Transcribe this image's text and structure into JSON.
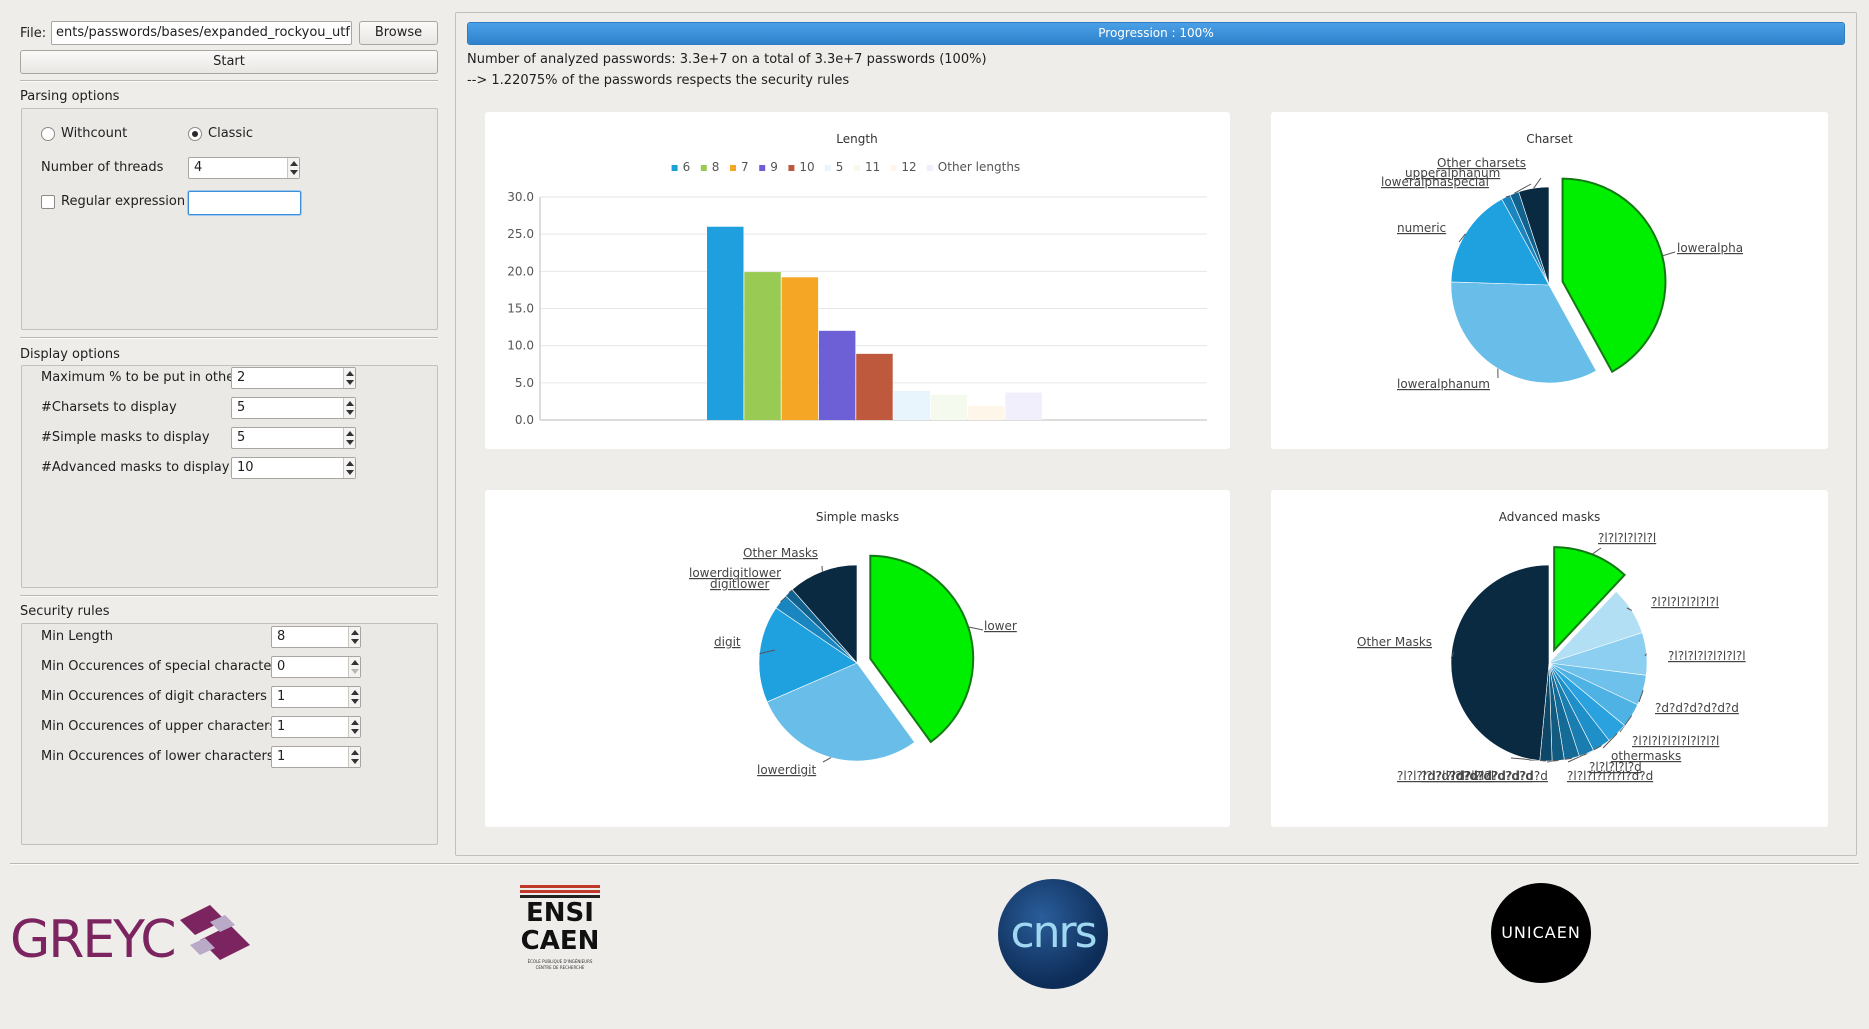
{
  "file": {
    "label": "File:",
    "path": "ents/passwords/bases/expanded_rockyou_utf8.txt",
    "browse_label": "Browse",
    "start_label": "Start"
  },
  "parsing": {
    "title": "Parsing options",
    "withcount_label": "Withcount",
    "classic_label": "Classic",
    "selected_mode": "Classic",
    "threads_label": "Number of threads",
    "threads_value": "4",
    "regex_label": "Regular expression",
    "regex_checked": false,
    "regex_value": ""
  },
  "display": {
    "title": "Display options",
    "rows": [
      {
        "label": "Maximum % to be put in other",
        "value": "2"
      },
      {
        "label": "#Charsets to display",
        "value": "5"
      },
      {
        "label": "#Simple masks to display",
        "value": "5"
      },
      {
        "label": "#Advanced masks to display",
        "value": "10"
      }
    ]
  },
  "security": {
    "title": "Security rules",
    "rows": [
      {
        "label": "Min Length",
        "value": "8"
      },
      {
        "label": "Min Occurences of special characters",
        "value": "0"
      },
      {
        "label": "Min Occurences of digit characters",
        "value": "1"
      },
      {
        "label": "Min Occurences of upper characters",
        "value": "1"
      },
      {
        "label": "Min Occurences of lower characters",
        "value": "1"
      }
    ]
  },
  "progress": {
    "label": "Progression : 100%",
    "value": 100,
    "color": "#3a8fd8"
  },
  "status": {
    "line1": "Number of analyzed passwords: 3.3e+7 on a total of 3.3e+7 passwords (100%)",
    "line2": "--> 1.22075% of the passwords respects the security rules"
  },
  "chart_data": [
    {
      "type": "bar",
      "title": "Length",
      "categories": [
        "6",
        "8",
        "7",
        "9",
        "10",
        "5",
        "11",
        "12",
        "Other lengths"
      ],
      "values": [
        26.0,
        19.9,
        19.2,
        12.0,
        8.9,
        3.9,
        3.4,
        1.9,
        3.7
      ],
      "colors": [
        "#209fdf",
        "#99ca53",
        "#f6a625",
        "#6d5fd5",
        "#bf593e",
        "#e9f5fc",
        "#f4faed",
        "#fef6e9",
        "#f0effb"
      ],
      "ylim": [
        0,
        30
      ],
      "yticks": [
        "0.0",
        "5.0",
        "10.0",
        "15.0",
        "20.0",
        "25.0",
        "30.0"
      ],
      "legend": "top",
      "grid": true
    },
    {
      "type": "pie",
      "title": "Charset",
      "labels": [
        "loweralpha",
        "loweralphanum",
        "numeric",
        "loweralphaspecial",
        "upperalphanum",
        "Other charsets"
      ],
      "values": [
        42.0,
        33.5,
        16.5,
        1.5,
        1.5,
        5.0
      ],
      "colors": [
        "#00ee00",
        "#68bde9",
        "#1fa0df",
        "#1a86c0",
        "#12628f",
        "#0a2a42"
      ],
      "exploded": "loweralpha"
    },
    {
      "type": "pie",
      "title": "Simple masks",
      "labels": [
        "lower",
        "lowerdigit",
        "digit",
        "digitlower",
        "lowerdigitlower",
        "Other Masks"
      ],
      "values": [
        40.0,
        28.5,
        16.0,
        2.5,
        1.5,
        11.5
      ],
      "colors": [
        "#00ee00",
        "#68bde9",
        "#1fa0df",
        "#1a86c0",
        "#12628f",
        "#0a2a42"
      ],
      "exploded": "lower"
    },
    {
      "type": "pie",
      "title": "Advanced masks",
      "labels": [
        "?l?l?l?l?l?l",
        "?l?l?l?l?l?l?l",
        "?l?l?l?l?l?l?l?l",
        "?d?d?d?d?d?d",
        "?l?l?l?l?l?l?l?l?l",
        "othermasks",
        "?l?l?l?l?d",
        "?l?l?l?l?l?l?d?d",
        "?d?d?d?d?d?d?d",
        "?d?d?d?d?d?d?d?d",
        "?l?l?l?l?l?l?l?l?l?l",
        "Other Masks"
      ],
      "values": [
        12.0,
        8.0,
        7.0,
        5.0,
        4.0,
        3.5,
        3.0,
        2.5,
        2.5,
        2.0,
        2.0,
        48.5
      ],
      "colors": [
        "#00ee00",
        "#b3dff4",
        "#8ccff0",
        "#6ec1ea",
        "#4fb2e5",
        "#2aa2df",
        "#1e8fc8",
        "#1a7db0",
        "#156b98",
        "#115a80",
        "#0d4868",
        "#0a2a42"
      ],
      "exploded": "?l?l?l?l?l?l"
    }
  ],
  "logos": {
    "greyc": "GREYC",
    "ensicaen_top": "ENSI",
    "ensicaen_bottom": "CAEN",
    "ensicaen_sub1": "ÉCOLE PUBLIQUE D'INGÉNIEURS",
    "ensicaen_sub2": "CENTRE DE RECHERCHE",
    "cnrs": "cnrs",
    "unicaen": "UNICAEN"
  }
}
